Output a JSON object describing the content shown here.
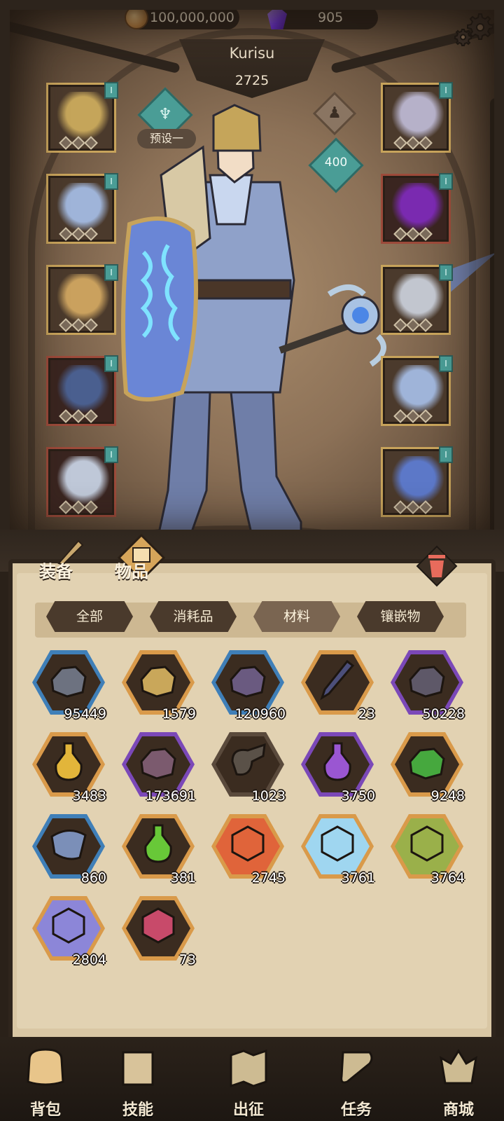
{
  "currency": {
    "coins": "100,000,000",
    "gems": "905"
  },
  "character": {
    "name": "Kurisu",
    "power": "2725",
    "preset_label": "预设一",
    "level": "400"
  },
  "equipment_left": [
    {
      "slot": "helmet",
      "icon": "helmet-icon",
      "badge": "I",
      "frame": "gold"
    },
    {
      "slot": "armor",
      "icon": "armor-icon",
      "badge": "I",
      "frame": "gold"
    },
    {
      "slot": "gloves",
      "icon": "gloves-icon",
      "badge": "I",
      "frame": "gold"
    },
    {
      "slot": "pants",
      "icon": "pants-icon",
      "badge": "I",
      "frame": "red"
    },
    {
      "slot": "boots",
      "icon": "boots-icon",
      "badge": "I",
      "frame": "red"
    }
  ],
  "equipment_right": [
    {
      "slot": "necklace",
      "icon": "necklace-icon",
      "badge": "I",
      "frame": "gold"
    },
    {
      "slot": "bracelet",
      "icon": "bracelet-icon",
      "badge": "I",
      "frame": "red"
    },
    {
      "slot": "ring",
      "icon": "ring-icon",
      "badge": "I",
      "frame": "gold"
    },
    {
      "slot": "weapon",
      "icon": "staff-icon",
      "badge": "I",
      "frame": "gold"
    },
    {
      "slot": "offhand",
      "icon": "shield-icon",
      "badge": "I",
      "frame": "gold"
    }
  ],
  "panel": {
    "tab_equip": "装备",
    "tab_items": "物品"
  },
  "filters": [
    {
      "label": "全部",
      "active": false
    },
    {
      "label": "消耗品",
      "active": false
    },
    {
      "label": "材料",
      "active": true
    },
    {
      "label": "镶嵌物",
      "active": false
    }
  ],
  "items": [
    {
      "icon": "iron-ore-icon",
      "count": "95449",
      "rarity": "blue"
    },
    {
      "icon": "gold-ore-icon",
      "count": "1579",
      "rarity": "orange"
    },
    {
      "icon": "amethyst-ore-icon",
      "count": "120960",
      "rarity": "blue"
    },
    {
      "icon": "ink-pen-icon",
      "count": "23",
      "rarity": "orange"
    },
    {
      "icon": "dark-ore-icon",
      "count": "50228",
      "rarity": "purple"
    },
    {
      "icon": "yellow-potion-icon",
      "count": "3483",
      "rarity": "orange"
    },
    {
      "icon": "crystal-cluster-icon",
      "count": "173691",
      "rarity": "purple"
    },
    {
      "icon": "scroll-bundle-icon",
      "count": "1023",
      "rarity": "none"
    },
    {
      "icon": "purple-potion-icon",
      "count": "3750",
      "rarity": "purple"
    },
    {
      "icon": "emerald-ore-icon",
      "count": "9248",
      "rarity": "orange"
    },
    {
      "icon": "blue-claw-icon",
      "count": "860",
      "rarity": "blue"
    },
    {
      "icon": "green-potion-icon",
      "count": "381",
      "rarity": "orange"
    },
    {
      "icon": "fire-rune-icon",
      "count": "2745",
      "rarity": "orange"
    },
    {
      "icon": "ice-rune-icon",
      "count": "3761",
      "rarity": "orange"
    },
    {
      "icon": "earth-rune-icon",
      "count": "3764",
      "rarity": "orange"
    },
    {
      "icon": "lightning-rune-icon",
      "count": "2804",
      "rarity": "orange"
    },
    {
      "icon": "demon-heart-icon",
      "count": "73",
      "rarity": "orange"
    }
  ],
  "nav": [
    {
      "label": "背包",
      "icon": "backpack-icon",
      "active": true
    },
    {
      "label": "技能",
      "icon": "skill-book-icon",
      "active": false
    },
    {
      "label": "出征",
      "icon": "battle-map-icon",
      "active": false
    },
    {
      "label": "任务",
      "icon": "quest-scroll-icon",
      "active": false
    },
    {
      "label": "商城",
      "icon": "shop-crown-icon",
      "active": false
    }
  ],
  "colors": {
    "rarity_blue": "#3f7fb8",
    "rarity_orange": "#d99a4a",
    "rarity_purple": "#7b48b8",
    "rarity_none": "#5a4a3c",
    "teal_accent": "#4a9d96"
  }
}
